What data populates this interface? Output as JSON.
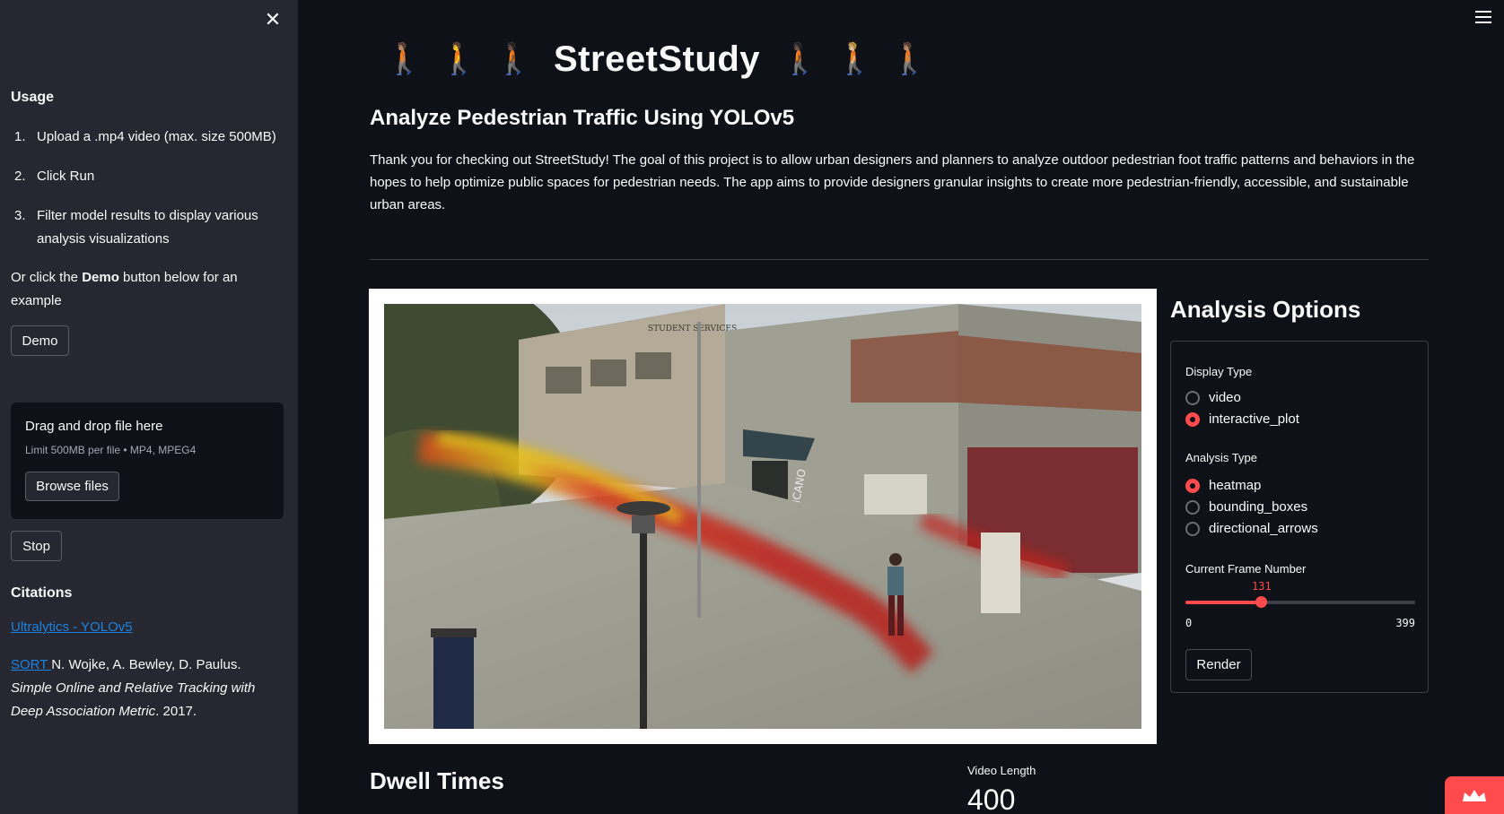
{
  "sidebar": {
    "usage_heading": "Usage",
    "usage_items": [
      {
        "num": "1.",
        "text": "Upload a .mp4 video (max. size 500MB)"
      },
      {
        "num": "2.",
        "text": "Click Run"
      },
      {
        "num": "3.",
        "text": "Filter model results to display various analysis visualizations"
      }
    ],
    "demo_hint_prefix": "Or click the ",
    "demo_hint_bold": "Demo",
    "demo_hint_suffix": " button below for an example",
    "demo_button": "Demo",
    "uploader": {
      "title": "Drag and drop file here",
      "limit": "Limit 500MB per file • MP4, MPEG4",
      "browse_button": "Browse files"
    },
    "stop_button": "Stop",
    "citations_heading": "Citations",
    "citation_link_1": "Ultralytics - YOLOv5",
    "citation_link_2": "SORT ",
    "citation_authors": "N. Wojke, A. Bewley, D. Paulus. ",
    "citation_title": "Simple Online and Relative Tracking with Deep Association Metric",
    "citation_year": ". 2017."
  },
  "header": {
    "title": "StreetStudy",
    "walkers_left": [
      "🚶🏽",
      "🚶",
      "🚶🏿"
    ],
    "walkers_right": [
      "🚶🏿",
      "🚶🏼",
      "🚶🏽"
    ],
    "subtitle": "Analyze Pedestrian Traffic Using YOLOv5",
    "intro": "Thank you for checking out StreetStudy! The goal of this project is to allow urban designers and planners to analyze outdoor pedestrian foot traffic patterns and behaviors in the hopes to help optimize public spaces for pedestrian needs. The app aims to provide designers granular insights to create more pedestrian-friendly, accessible, and sustainable urban areas."
  },
  "video": {
    "sign_text": "STUDENT SERVICES",
    "building_label": "CHICANO"
  },
  "analysis_options": {
    "title": "Analysis Options",
    "display_type_label": "Display Type",
    "display_types": [
      {
        "label": "video",
        "selected": false
      },
      {
        "label": "interactive_plot",
        "selected": true
      }
    ],
    "analysis_type_label": "Analysis Type",
    "analysis_types": [
      {
        "label": "heatmap",
        "selected": true
      },
      {
        "label": "bounding_boxes",
        "selected": false
      },
      {
        "label": "directional_arrows",
        "selected": false
      }
    ],
    "frame_label": "Current Frame Number",
    "frame_value": "131",
    "frame_min": "0",
    "frame_max": "399",
    "render_button": "Render"
  },
  "dwell": {
    "title": "Dwell Times",
    "video_length_label": "Video Length",
    "video_length_value": "400"
  },
  "colors": {
    "accent": "#ff4b4b",
    "link": "#1c83e1",
    "background": "#0e1117",
    "sidebar": "#262730"
  }
}
